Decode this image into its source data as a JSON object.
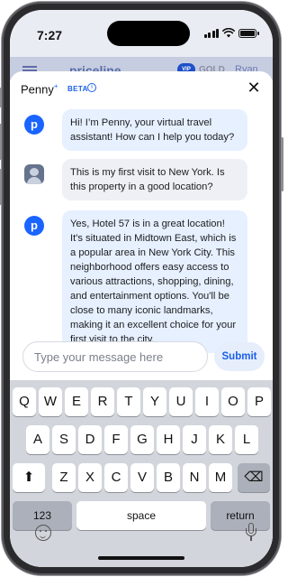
{
  "status_bar": {
    "time": "7:27"
  },
  "background_app": {
    "logo": "priceline",
    "vip_badge": "VIP",
    "tier": "GOLD",
    "user_name": "Ryan"
  },
  "chat": {
    "title": "Penny",
    "title_mark": "+",
    "beta_label": "BETA",
    "info_glyph": "i",
    "close_glyph": "✕",
    "penny_avatar_glyph": "p",
    "messages": [
      {
        "sender": "penny",
        "text": "Hi! I’m Penny, your virtual travel assistant! How can I help you today?"
      },
      {
        "sender": "user",
        "text": "This is my first visit to New York. Is this property in a good location?"
      },
      {
        "sender": "penny",
        "text": "Yes, Hotel 57 is in a great location! It's situated in Midtown East, which is a popular area in New York City. This neighborhood offers easy access to various attractions, shopping, dining, and entertainment options. You'll be close to many iconic landmarks, making it an excellent choice for your first visit to the city."
      }
    ],
    "input_placeholder": "Type your message here",
    "submit_label": "Submit"
  },
  "keyboard": {
    "row1": [
      "Q",
      "W",
      "E",
      "R",
      "T",
      "Y",
      "U",
      "I",
      "O",
      "P"
    ],
    "row2": [
      "A",
      "S",
      "D",
      "F",
      "G",
      "H",
      "J",
      "K",
      "L"
    ],
    "row3": [
      "Z",
      "X",
      "C",
      "V",
      "B",
      "N",
      "M"
    ],
    "shift_glyph": "⬆",
    "backspace_glyph": "⌫",
    "numbers_label": "123",
    "space_label": "space",
    "return_label": "return"
  },
  "colors": {
    "accent": "#1a64ff",
    "penny_bubble": "#e6f0ff",
    "user_bubble": "#eef0f5",
    "keyboard_bg": "#d2d5db"
  }
}
